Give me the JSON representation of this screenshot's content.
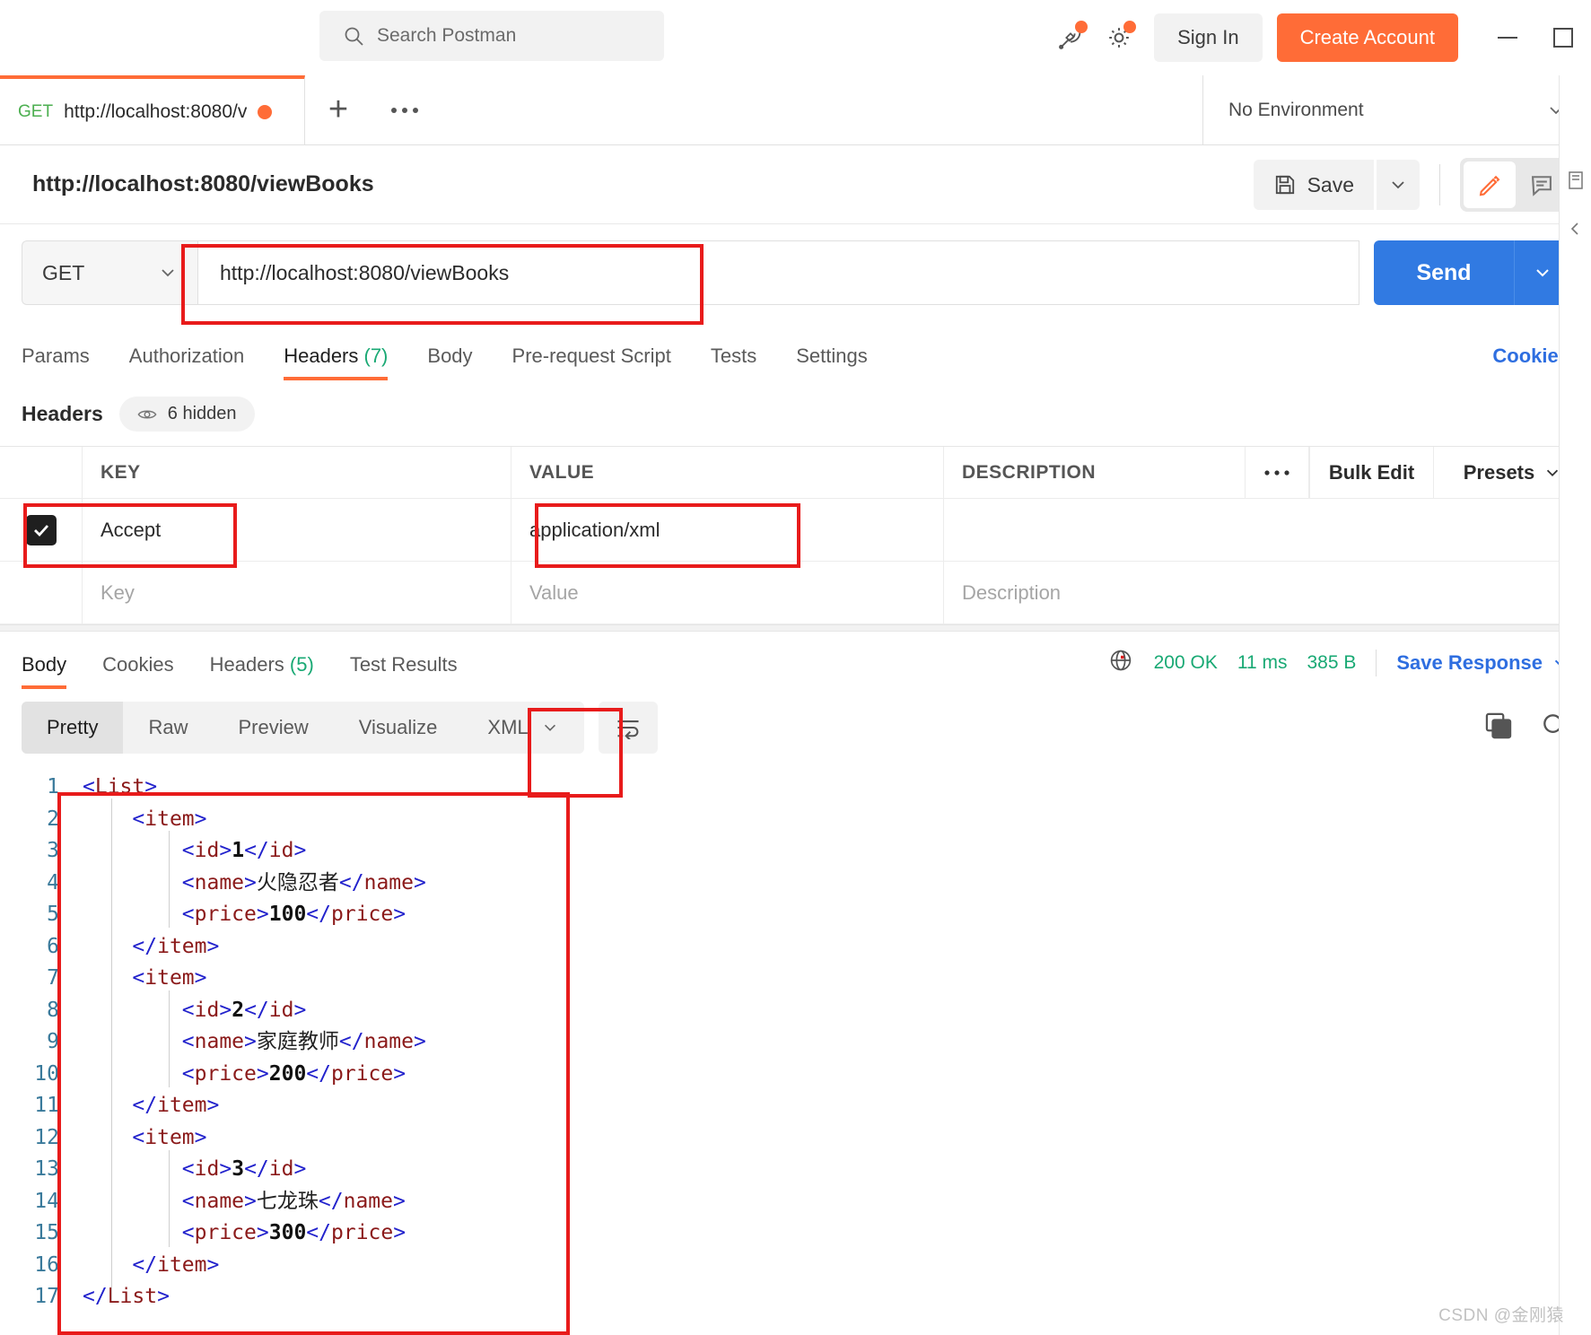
{
  "window": {
    "minimize_icon": "minimize-icon",
    "maximize_icon": "maximize-icon"
  },
  "topbar": {
    "search_placeholder": "Search Postman",
    "search_icon": "search-icon",
    "satellite_icon": "satellite-icon",
    "gear_icon": "gear-icon",
    "sign_in_label": "Sign In",
    "create_account_label": "Create Account"
  },
  "tabstrip": {
    "tab": {
      "method": "GET",
      "url": "http://localhost:8080/v",
      "unsaved_icon": "unsaved-dot-icon"
    },
    "new_tab_icon": "plus-icon",
    "more_icon": "ellipsis-icon",
    "environment": "No Environment",
    "environment_caret_icon": "chevron-down-icon"
  },
  "request": {
    "name": "http://localhost:8080/viewBooks",
    "save_label": "Save",
    "save_icon": "floppy-disk-icon",
    "save_caret_icon": "chevron-down-icon",
    "edit_icon": "pencil-icon",
    "comment_icon": "comment-icon",
    "method": "GET",
    "method_caret_icon": "chevron-down-icon",
    "url": "http://localhost:8080/viewBooks",
    "send_label": "Send",
    "send_caret_icon": "chevron-down-icon",
    "tabs": [
      {
        "label": "Params",
        "count": "",
        "active": false
      },
      {
        "label": "Authorization",
        "count": "",
        "active": false
      },
      {
        "label": "Headers",
        "count": "(7)",
        "active": true
      },
      {
        "label": "Body",
        "count": "",
        "active": false
      },
      {
        "label": "Pre-request Script",
        "count": "",
        "active": false
      },
      {
        "label": "Tests",
        "count": "",
        "active": false
      },
      {
        "label": "Settings",
        "count": "",
        "active": false
      }
    ],
    "cookies_link": "Cookies"
  },
  "headers_panel": {
    "title": "Headers",
    "hidden_chip": "6 hidden",
    "eye_icon": "eye-icon",
    "columns": {
      "key": "KEY",
      "value": "VALUE",
      "description": "DESCRIPTION"
    },
    "more_icon": "ellipsis-icon",
    "bulk_edit_label": "Bulk Edit",
    "presets_label": "Presets",
    "presets_caret_icon": "chevron-down-icon",
    "rows": [
      {
        "checked": true,
        "key": "Accept",
        "value": "application/xml",
        "description": ""
      }
    ],
    "new_row": {
      "key_placeholder": "Key",
      "value_placeholder": "Value",
      "description_placeholder": "Description"
    }
  },
  "response": {
    "tabs": [
      {
        "label": "Body",
        "count": "",
        "active": true
      },
      {
        "label": "Cookies",
        "count": "",
        "active": false
      },
      {
        "label": "Headers",
        "count": "(5)",
        "active": false
      },
      {
        "label": "Test Results",
        "count": "",
        "active": false
      }
    ],
    "globe_icon": "globe-icon",
    "status": "200 OK",
    "time": "11 ms",
    "size": "385 B",
    "save_response_label": "Save Response",
    "save_response_caret_icon": "chevron-down-icon",
    "view_modes": [
      "Pretty",
      "Raw",
      "Preview",
      "Visualize"
    ],
    "active_view_mode": "Pretty",
    "format": "XML",
    "format_caret_icon": "chevron-down-icon",
    "wrap_icon": "wrap-lines-icon",
    "copy_icon": "copy-icon",
    "search_icon": "search-icon",
    "code": [
      {
        "n": "1",
        "indent": 0,
        "tokens": [
          {
            "t": "br",
            "v": "<"
          },
          {
            "t": "tag",
            "v": "List"
          },
          {
            "t": "br",
            "v": ">"
          }
        ]
      },
      {
        "n": "2",
        "indent": 1,
        "tokens": [
          {
            "t": "br",
            "v": "<"
          },
          {
            "t": "tag",
            "v": "item"
          },
          {
            "t": "br",
            "v": ">"
          }
        ]
      },
      {
        "n": "3",
        "indent": 2,
        "tokens": [
          {
            "t": "br",
            "v": "<"
          },
          {
            "t": "tag",
            "v": "id"
          },
          {
            "t": "br",
            "v": ">"
          },
          {
            "t": "txt",
            "v": "1"
          },
          {
            "t": "br",
            "v": "</"
          },
          {
            "t": "tag",
            "v": "id"
          },
          {
            "t": "br",
            "v": ">"
          }
        ]
      },
      {
        "n": "4",
        "indent": 2,
        "tokens": [
          {
            "t": "br",
            "v": "<"
          },
          {
            "t": "tag",
            "v": "name"
          },
          {
            "t": "br",
            "v": ">"
          },
          {
            "t": "cjk",
            "v": "火隐忍者"
          },
          {
            "t": "br",
            "v": "</"
          },
          {
            "t": "tag",
            "v": "name"
          },
          {
            "t": "br",
            "v": ">"
          }
        ]
      },
      {
        "n": "5",
        "indent": 2,
        "tokens": [
          {
            "t": "br",
            "v": "<"
          },
          {
            "t": "tag",
            "v": "price"
          },
          {
            "t": "br",
            "v": ">"
          },
          {
            "t": "txt",
            "v": "100"
          },
          {
            "t": "br",
            "v": "</"
          },
          {
            "t": "tag",
            "v": "price"
          },
          {
            "t": "br",
            "v": ">"
          }
        ]
      },
      {
        "n": "6",
        "indent": 1,
        "tokens": [
          {
            "t": "br",
            "v": "</"
          },
          {
            "t": "tag",
            "v": "item"
          },
          {
            "t": "br",
            "v": ">"
          }
        ]
      },
      {
        "n": "7",
        "indent": 1,
        "tokens": [
          {
            "t": "br",
            "v": "<"
          },
          {
            "t": "tag",
            "v": "item"
          },
          {
            "t": "br",
            "v": ">"
          }
        ]
      },
      {
        "n": "8",
        "indent": 2,
        "tokens": [
          {
            "t": "br",
            "v": "<"
          },
          {
            "t": "tag",
            "v": "id"
          },
          {
            "t": "br",
            "v": ">"
          },
          {
            "t": "txt",
            "v": "2"
          },
          {
            "t": "br",
            "v": "</"
          },
          {
            "t": "tag",
            "v": "id"
          },
          {
            "t": "br",
            "v": ">"
          }
        ]
      },
      {
        "n": "9",
        "indent": 2,
        "tokens": [
          {
            "t": "br",
            "v": "<"
          },
          {
            "t": "tag",
            "v": "name"
          },
          {
            "t": "br",
            "v": ">"
          },
          {
            "t": "cjk",
            "v": "家庭教师"
          },
          {
            "t": "br",
            "v": "</"
          },
          {
            "t": "tag",
            "v": "name"
          },
          {
            "t": "br",
            "v": ">"
          }
        ]
      },
      {
        "n": "10",
        "indent": 2,
        "tokens": [
          {
            "t": "br",
            "v": "<"
          },
          {
            "t": "tag",
            "v": "price"
          },
          {
            "t": "br",
            "v": ">"
          },
          {
            "t": "txt",
            "v": "200"
          },
          {
            "t": "br",
            "v": "</"
          },
          {
            "t": "tag",
            "v": "price"
          },
          {
            "t": "br",
            "v": ">"
          }
        ]
      },
      {
        "n": "11",
        "indent": 1,
        "tokens": [
          {
            "t": "br",
            "v": "</"
          },
          {
            "t": "tag",
            "v": "item"
          },
          {
            "t": "br",
            "v": ">"
          }
        ]
      },
      {
        "n": "12",
        "indent": 1,
        "tokens": [
          {
            "t": "br",
            "v": "<"
          },
          {
            "t": "tag",
            "v": "item"
          },
          {
            "t": "br",
            "v": ">"
          }
        ]
      },
      {
        "n": "13",
        "indent": 2,
        "tokens": [
          {
            "t": "br",
            "v": "<"
          },
          {
            "t": "tag",
            "v": "id"
          },
          {
            "t": "br",
            "v": ">"
          },
          {
            "t": "txt",
            "v": "3"
          },
          {
            "t": "br",
            "v": "</"
          },
          {
            "t": "tag",
            "v": "id"
          },
          {
            "t": "br",
            "v": ">"
          }
        ]
      },
      {
        "n": "14",
        "indent": 2,
        "tokens": [
          {
            "t": "br",
            "v": "<"
          },
          {
            "t": "tag",
            "v": "name"
          },
          {
            "t": "br",
            "v": ">"
          },
          {
            "t": "cjk",
            "v": "七龙珠"
          },
          {
            "t": "br",
            "v": "</"
          },
          {
            "t": "tag",
            "v": "name"
          },
          {
            "t": "br",
            "v": ">"
          }
        ]
      },
      {
        "n": "15",
        "indent": 2,
        "tokens": [
          {
            "t": "br",
            "v": "<"
          },
          {
            "t": "tag",
            "v": "price"
          },
          {
            "t": "br",
            "v": ">"
          },
          {
            "t": "txt",
            "v": "300"
          },
          {
            "t": "br",
            "v": "</"
          },
          {
            "t": "tag",
            "v": "price"
          },
          {
            "t": "br",
            "v": ">"
          }
        ]
      },
      {
        "n": "16",
        "indent": 1,
        "tokens": [
          {
            "t": "br",
            "v": "</"
          },
          {
            "t": "tag",
            "v": "item"
          },
          {
            "t": "br",
            "v": ">"
          }
        ]
      },
      {
        "n": "17",
        "indent": 0,
        "tokens": [
          {
            "t": "br",
            "v": "</"
          },
          {
            "t": "tag",
            "v": "List"
          },
          {
            "t": "br",
            "v": ">"
          }
        ]
      }
    ]
  },
  "watermark": "CSDN @金刚猿",
  "colors": {
    "accent_orange": "#ff6c37",
    "send_blue": "#317ae2",
    "link_blue": "#2e6ee0",
    "status_green": "#19a974",
    "annotation_red": "#e81b1b",
    "tag_red": "#8b1a1a",
    "bracket_blue": "#2222cc"
  }
}
